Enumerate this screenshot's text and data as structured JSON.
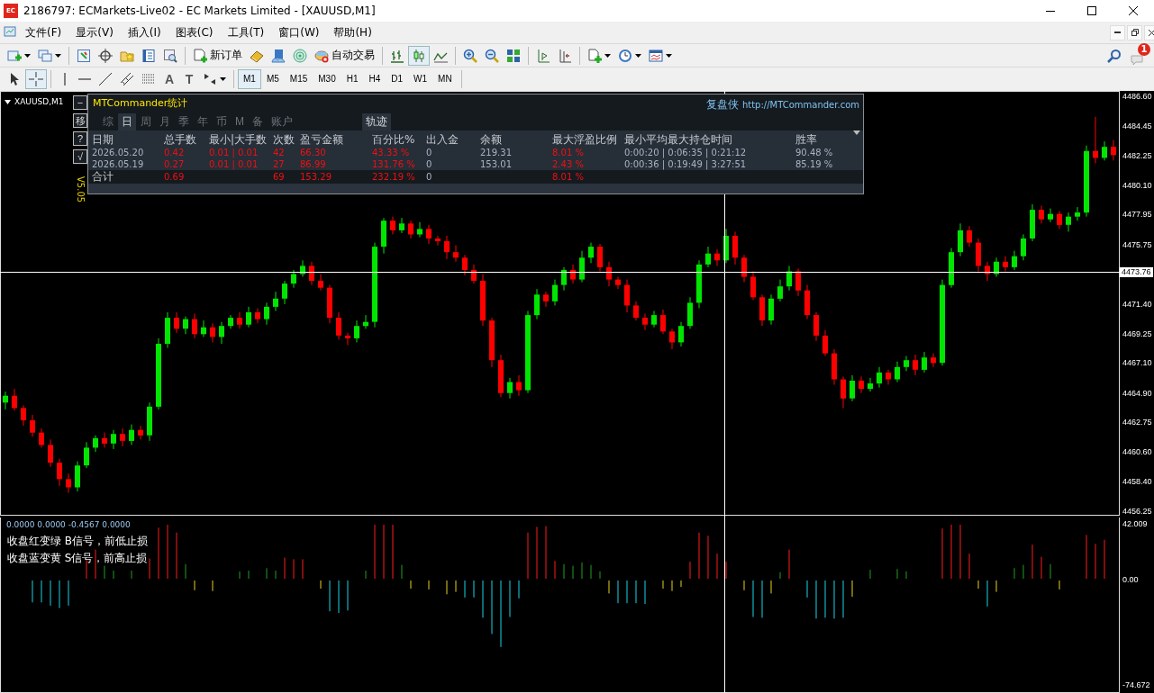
{
  "window": {
    "app_icon_text": "EC",
    "title": "2186797: ECMarkets-Live02 - EC Markets Limited - [XAUUSD,M1]"
  },
  "menu": {
    "items": [
      "文件(F)",
      "显示(V)",
      "插入(I)",
      "图表(C)",
      "工具(T)",
      "窗口(W)",
      "帮助(H)"
    ]
  },
  "toolbar": {
    "items": [
      {
        "kind": "newchart"
      },
      {
        "kind": "profiles"
      },
      {
        "kind": "sep"
      },
      {
        "kind": "marketwatch"
      },
      {
        "kind": "datawindow"
      },
      {
        "kind": "navigator"
      },
      {
        "kind": "terminal"
      },
      {
        "kind": "tester"
      },
      {
        "kind": "sep"
      },
      {
        "kind": "neworder",
        "label": "新订单"
      },
      {
        "kind": "editor"
      },
      {
        "kind": "mail"
      },
      {
        "kind": "signals"
      },
      {
        "kind": "autotrade",
        "label": "自动交易"
      },
      {
        "kind": "sep"
      },
      {
        "kind": "bars",
        "selected": false
      },
      {
        "kind": "candles",
        "selected": true
      },
      {
        "kind": "line",
        "selected": false
      },
      {
        "kind": "sep"
      },
      {
        "kind": "zoomin"
      },
      {
        "kind": "zoomout"
      },
      {
        "kind": "tile"
      },
      {
        "kind": "sep"
      },
      {
        "kind": "autoscroll"
      },
      {
        "kind": "shift"
      },
      {
        "kind": "sep"
      },
      {
        "kind": "indicators"
      },
      {
        "kind": "periods"
      },
      {
        "kind": "templates"
      }
    ],
    "notification_badge": "1"
  },
  "drawing_tools": [
    {
      "kind": "cursor",
      "selected": false
    },
    {
      "kind": "crosshair",
      "selected": true
    },
    {
      "kind": "sep"
    },
    {
      "kind": "vline",
      "selected": false
    },
    {
      "kind": "hline",
      "selected": false
    },
    {
      "kind": "trend",
      "selected": false
    },
    {
      "kind": "channel",
      "selected": false
    },
    {
      "kind": "fibo",
      "selected": false
    },
    {
      "kind": "text",
      "label": "A",
      "selected": false
    },
    {
      "kind": "label",
      "label": "T",
      "selected": false
    },
    {
      "kind": "arrows",
      "selected": false
    }
  ],
  "timeframes": [
    {
      "label": "M1",
      "selected": true
    },
    {
      "label": "M5",
      "selected": false
    },
    {
      "label": "M15",
      "selected": false
    },
    {
      "label": "M30",
      "selected": false
    },
    {
      "label": "H1",
      "selected": false
    },
    {
      "label": "H4",
      "selected": false
    },
    {
      "label": "D1",
      "selected": false
    },
    {
      "label": "W1",
      "selected": false
    },
    {
      "label": "MN",
      "selected": false
    }
  ],
  "chart": {
    "symbol": "XAUUSD,M1",
    "current_price": "4473.76",
    "chart_data": {
      "type": "candlestick",
      "ylim": [
        4455.99,
        4486.93
      ],
      "yticks": [
        {
          "value": 4486.6,
          "label": "4486.60"
        },
        {
          "value": 4484.45,
          "label": "4484.45"
        },
        {
          "value": 4482.25,
          "label": "4482.25"
        },
        {
          "value": 4480.1,
          "label": "4480.10"
        },
        {
          "value": 4477.95,
          "label": "4477.95"
        },
        {
          "value": 4475.75,
          "label": "4475.75"
        },
        {
          "value": 4471.4,
          "label": "4471.40"
        },
        {
          "value": 4469.25,
          "label": "4469.25"
        },
        {
          "value": 4467.1,
          "label": "4467.10"
        },
        {
          "value": 4464.9,
          "label": "4464.90"
        },
        {
          "value": 4462.75,
          "label": "4462.75"
        },
        {
          "value": 4460.6,
          "label": "4460.60"
        },
        {
          "value": 4458.4,
          "label": "4458.40"
        },
        {
          "value": 4456.25,
          "label": "4456.25"
        }
      ],
      "ohlc": [
        [
          4464.2,
          4465.0,
          4463.7,
          4464.7
        ],
        [
          4464.7,
          4465.2,
          4463.6,
          4463.8
        ],
        [
          4463.8,
          4464.0,
          4462.5,
          4462.9
        ],
        [
          4462.9,
          4463.3,
          4461.7,
          4462.0
        ],
        [
          4462.0,
          4462.3,
          4460.9,
          4461.1
        ],
        [
          4461.1,
          4461.5,
          4459.5,
          4459.8
        ],
        [
          4459.8,
          4460.1,
          4458.1,
          4458.6
        ],
        [
          4458.6,
          4459.0,
          4457.6,
          4458.0
        ],
        [
          4458.0,
          4459.9,
          4457.7,
          4459.6
        ],
        [
          4459.6,
          4461.3,
          4459.4,
          4460.9
        ],
        [
          4460.9,
          4461.8,
          4460.6,
          4461.6
        ],
        [
          4461.6,
          4462.0,
          4460.9,
          4461.2
        ],
        [
          4461.2,
          4462.2,
          4460.8,
          4461.9
        ],
        [
          4461.9,
          4462.3,
          4461.0,
          4461.4
        ],
        [
          4461.4,
          4462.6,
          4461.1,
          4462.2
        ],
        [
          4462.2,
          4462.5,
          4461.5,
          4461.8
        ],
        [
          4461.8,
          4464.2,
          4461.4,
          4463.9
        ],
        [
          4463.9,
          4468.9,
          4463.7,
          4468.5
        ],
        [
          4468.5,
          4470.8,
          4468.2,
          4470.4
        ],
        [
          4470.4,
          4470.8,
          4469.3,
          4469.6
        ],
        [
          4469.6,
          4470.5,
          4469.2,
          4470.3
        ],
        [
          4470.3,
          4470.7,
          4468.9,
          4469.2
        ],
        [
          4469.2,
          4470.2,
          4469.0,
          4469.7
        ],
        [
          4469.7,
          4470.0,
          4468.6,
          4469.0
        ],
        [
          4469.0,
          4470.1,
          4468.5,
          4469.8
        ],
        [
          4469.8,
          4470.6,
          4469.6,
          4470.4
        ],
        [
          4470.4,
          4470.8,
          4469.6,
          4469.9
        ],
        [
          4469.9,
          4471.2,
          4469.7,
          4470.8
        ],
        [
          4470.8,
          4471.1,
          4470.0,
          4470.3
        ],
        [
          4470.3,
          4471.5,
          4469.9,
          4471.2
        ],
        [
          4471.2,
          4472.3,
          4470.9,
          4471.8
        ],
        [
          4471.8,
          4473.1,
          4471.4,
          4472.9
        ],
        [
          4472.9,
          4473.9,
          4472.6,
          4473.6
        ],
        [
          4473.6,
          4474.6,
          4473.4,
          4474.2
        ],
        [
          4474.2,
          4474.5,
          4472.8,
          4473.1
        ],
        [
          4473.1,
          4473.6,
          4472.4,
          4472.6
        ],
        [
          4472.6,
          4472.8,
          4470.0,
          4470.4
        ],
        [
          4470.4,
          4470.8,
          4468.8,
          4469.1
        ],
        [
          4469.1,
          4469.3,
          4468.4,
          4468.9
        ],
        [
          4468.9,
          4470.2,
          4468.6,
          4469.8
        ],
        [
          4469.8,
          4470.6,
          4469.6,
          4470.1
        ],
        [
          4470.1,
          4475.9,
          4469.7,
          4475.6
        ],
        [
          4475.6,
          4477.7,
          4475.1,
          4477.5
        ],
        [
          4477.5,
          4477.8,
          4476.5,
          4476.8
        ],
        [
          4476.8,
          4477.7,
          4476.6,
          4477.3
        ],
        [
          4477.3,
          4477.5,
          4476.2,
          4476.5
        ],
        [
          4476.5,
          4477.4,
          4476.3,
          4476.9
        ],
        [
          4476.9,
          4477.2,
          4475.8,
          4476.2
        ],
        [
          4476.2,
          4476.4,
          4475.7,
          4476.0
        ],
        [
          4476.0,
          4476.4,
          4474.7,
          4475.2
        ],
        [
          4475.2,
          4475.7,
          4474.5,
          4474.8
        ],
        [
          4474.8,
          4475.0,
          4473.5,
          4473.9
        ],
        [
          4473.9,
          4474.3,
          4472.9,
          4473.1
        ],
        [
          4473.1,
          4473.6,
          4469.8,
          4470.2
        ],
        [
          4470.2,
          4470.4,
          4466.8,
          4467.3
        ],
        [
          4467.3,
          4467.7,
          4464.6,
          4464.9
        ],
        [
          4464.9,
          4466.0,
          4464.5,
          4465.7
        ],
        [
          4465.7,
          4466.2,
          4464.7,
          4465.1
        ],
        [
          4465.1,
          4470.9,
          4464.9,
          4470.6
        ],
        [
          4470.6,
          4472.5,
          4470.3,
          4472.1
        ],
        [
          4472.1,
          4472.3,
          4471.2,
          4471.6
        ],
        [
          4471.6,
          4473.2,
          4471.3,
          4472.8
        ],
        [
          4472.8,
          4474.1,
          4472.4,
          4473.9
        ],
        [
          4473.9,
          4474.3,
          4472.9,
          4473.2
        ],
        [
          4473.2,
          4475.3,
          4473.0,
          4474.8
        ],
        [
          4474.8,
          4475.9,
          4474.4,
          4475.6
        ],
        [
          4475.6,
          4475.8,
          4473.8,
          4474.1
        ],
        [
          4474.1,
          4474.5,
          4472.7,
          4473.2
        ],
        [
          4473.2,
          4473.4,
          4472.5,
          4472.8
        ],
        [
          4472.8,
          4473.2,
          4470.8,
          4471.3
        ],
        [
          4471.3,
          4471.6,
          4470.2,
          4470.4
        ],
        [
          4470.4,
          4470.7,
          4469.5,
          4469.9
        ],
        [
          4469.9,
          4470.9,
          4469.7,
          4470.6
        ],
        [
          4470.6,
          4471.0,
          4469.2,
          4469.4
        ],
        [
          4469.4,
          4469.6,
          4468.1,
          4468.6
        ],
        [
          4468.6,
          4470.1,
          4468.3,
          4469.8
        ],
        [
          4469.8,
          4471.9,
          4469.6,
          4471.5
        ],
        [
          4471.5,
          4474.6,
          4471.1,
          4474.3
        ],
        [
          4474.3,
          4475.6,
          4474.1,
          4475.1
        ],
        [
          4475.1,
          4475.4,
          4474.2,
          4474.6
        ],
        [
          4474.6,
          4476.9,
          4474.4,
          4476.4
        ],
        [
          4476.4,
          4476.7,
          4474.3,
          4474.8
        ],
        [
          4474.8,
          4475.0,
          4473.0,
          4473.4
        ],
        [
          4473.4,
          4473.8,
          4471.7,
          4471.9
        ],
        [
          4471.9,
          4472.1,
          4469.8,
          4470.2
        ],
        [
          4470.2,
          4472.1,
          4469.9,
          4471.8
        ],
        [
          4471.8,
          4473.2,
          4471.6,
          4472.7
        ],
        [
          4472.7,
          4474.2,
          4472.4,
          4473.8
        ],
        [
          4473.8,
          4474.0,
          4472.0,
          4472.4
        ],
        [
          4472.4,
          4472.8,
          4470.3,
          4470.6
        ],
        [
          4470.6,
          4470.8,
          4468.7,
          4469.1
        ],
        [
          4469.1,
          4469.5,
          4467.6,
          4467.8
        ],
        [
          4467.8,
          4468.1,
          4465.5,
          4465.9
        ],
        [
          4465.9,
          4466.1,
          4463.8,
          4464.5
        ],
        [
          4464.5,
          4466.2,
          4464.3,
          4465.8
        ],
        [
          4465.8,
          4466.1,
          4464.9,
          4465.2
        ],
        [
          4465.2,
          4466.0,
          4465.0,
          4465.6
        ],
        [
          4465.6,
          4466.8,
          4465.3,
          4466.4
        ],
        [
          4466.4,
          4466.6,
          4465.5,
          4465.9
        ],
        [
          4465.9,
          4467.2,
          4465.7,
          4466.8
        ],
        [
          4466.8,
          4467.6,
          4466.5,
          4467.3
        ],
        [
          4467.3,
          4467.7,
          4466.2,
          4466.6
        ],
        [
          4466.6,
          4467.9,
          4466.4,
          4467.5
        ],
        [
          4467.5,
          4467.8,
          4466.8,
          4467.1
        ],
        [
          4467.1,
          4473.2,
          4466.9,
          4472.8
        ],
        [
          4472.8,
          4475.5,
          4472.6,
          4475.2
        ],
        [
          4475.2,
          4477.3,
          4474.9,
          4476.8
        ],
        [
          4476.8,
          4477.1,
          4475.6,
          4475.9
        ],
        [
          4475.9,
          4476.2,
          4473.8,
          4474.2
        ],
        [
          4474.2,
          4474.5,
          4473.1,
          4473.6
        ],
        [
          4473.6,
          4474.8,
          4473.4,
          4474.5
        ],
        [
          4474.5,
          4474.9,
          4473.8,
          4474.1
        ],
        [
          4474.1,
          4475.3,
          4473.9,
          4474.9
        ],
        [
          4474.9,
          4476.5,
          4474.6,
          4476.2
        ],
        [
          4476.2,
          4478.7,
          4476.0,
          4478.3
        ],
        [
          4478.3,
          4478.6,
          4477.3,
          4477.6
        ],
        [
          4477.6,
          4478.4,
          4477.4,
          4478.0
        ],
        [
          4478.0,
          4478.2,
          4476.9,
          4477.2
        ],
        [
          4477.2,
          4478.1,
          4476.7,
          4477.8
        ],
        [
          4477.8,
          4478.5,
          4477.5,
          4478.1
        ],
        [
          4478.1,
          4483.0,
          4477.8,
          4482.6
        ],
        [
          4482.6,
          4485.1,
          4481.7,
          4482.1
        ],
        [
          4482.1,
          4483.3,
          4481.9,
          4482.9
        ],
        [
          4482.9,
          4483.4,
          4481.9,
          4482.3
        ]
      ]
    }
  },
  "stats_panel": {
    "side_buttons": [
      "−",
      "移",
      "?",
      "√"
    ],
    "version": "V5.05",
    "title": "MTCommander统计",
    "brand": "复盘侠",
    "link": "http://MTCommander.com",
    "tabs": [
      {
        "label": "综",
        "selected": false
      },
      {
        "label": "日",
        "selected": true
      },
      {
        "label": "周",
        "selected": false
      },
      {
        "label": "月",
        "selected": false
      },
      {
        "label": "季",
        "selected": false
      },
      {
        "label": "年",
        "selected": false
      },
      {
        "label": "币",
        "selected": false
      },
      {
        "label": "M",
        "selected": false
      },
      {
        "label": "备",
        "selected": false
      },
      {
        "label": "账户",
        "selected": false
      }
    ],
    "track_button": {
      "label": "轨迹",
      "on": true
    },
    "columns": [
      {
        "label": "日期",
        "kind": "plain",
        "in_total": true
      },
      {
        "label": "总手数",
        "kind": "red",
        "in_total": true
      },
      {
        "label": "最小|大手数",
        "kind": "red",
        "in_total": false
      },
      {
        "label": "次数",
        "kind": "red",
        "in_total": true
      },
      {
        "label": "盈亏金额",
        "kind": "red",
        "in_total": true
      },
      {
        "label": "百分比%",
        "kind": "red",
        "in_total": true
      },
      {
        "label": "出入金",
        "kind": "plain",
        "in_total": true
      },
      {
        "label": "余额",
        "kind": "plain",
        "in_total": false
      },
      {
        "label": "最大浮盈比例",
        "kind": "red",
        "in_total": true
      },
      {
        "label": "最小平均最大持仓时间",
        "kind": "plain",
        "in_total": false
      },
      {
        "label": "胜率",
        "kind": "plain",
        "in_total": false
      }
    ],
    "rows": [
      [
        "2026.05.20",
        "0.42",
        "0.01 | 0.01",
        "42",
        "66.30",
        "43.33 %",
        "0",
        "219.31",
        "8.01 %",
        "0:00:20 | 0:06:35 | 0:21:12",
        "90.48 %"
      ],
      [
        "2026.05.19",
        "0.27",
        "0.01 | 0.01",
        "27",
        "86.99",
        "131.76 %",
        "0",
        "153.01",
        "2.43 %",
        "0:00:36 | 0:19:49 | 3:27:51",
        "85.19 %"
      ]
    ],
    "total": [
      "合计",
      "0.69",
      "69",
      "153.29",
      "232.19 %",
      "0",
      "8.01 %"
    ]
  },
  "indicator": {
    "values": "0.0000 0.0000 -0.4567 0.0000",
    "notes": [
      "收盘红变绿 B信号，前低止损",
      "收盘蓝变黄 S信号，前高止损"
    ],
    "axis": [
      "42.009",
      "0.00",
      "-74.672"
    ]
  }
}
